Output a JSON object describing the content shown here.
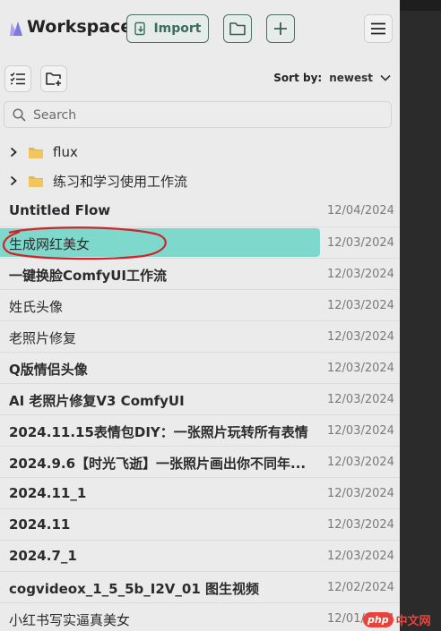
{
  "header": {
    "title": "Workspace",
    "import_label": "Import",
    "icons": {
      "logo": "workspace-logo",
      "import": "import-icon",
      "folder": "folder-icon",
      "add": "plus-icon",
      "menu": "hamburger-icon"
    }
  },
  "toolbar": {
    "sort_label": "Sort by:",
    "sort_value": "newest"
  },
  "search": {
    "placeholder": "Search"
  },
  "folders": [
    {
      "name": "flux"
    },
    {
      "name": "练习和学习使用工作流"
    }
  ],
  "flows": [
    {
      "name": "Untitled Flow",
      "date": "12/04/2024"
    },
    {
      "name": "生成网红美女",
      "date": "12/03/2024",
      "selected": true
    },
    {
      "name": "一键换脸ComfyUI工作流",
      "date": "12/03/2024"
    },
    {
      "name": "姓氏头像",
      "date": "12/03/2024"
    },
    {
      "name": "老照片修复",
      "date": "12/03/2024"
    },
    {
      "name": "Q版情侣头像",
      "date": "12/03/2024"
    },
    {
      "name": "AI 老照片修复V3 ComfyUI",
      "date": "12/03/2024"
    },
    {
      "name": "2024.11.15表情包DIY：一张照片玩转所有表情",
      "date": "12/03/2024"
    },
    {
      "name": "2024.9.6【时光飞逝】一张照片画出你不同年...",
      "date": "12/03/2024"
    },
    {
      "name": "2024.11_1",
      "date": "12/03/2024"
    },
    {
      "name": "2024.11",
      "date": "12/03/2024"
    },
    {
      "name": "2024.7_1",
      "date": "12/03/2024"
    },
    {
      "name": "cogvideox_1_5_5b_I2V_01 图生视频",
      "date": "12/02/2024"
    },
    {
      "name": "小红书写实逼真美女",
      "date": "12/01/2024"
    }
  ],
  "colors": {
    "accent": "#3c6b5f",
    "selected": "#7ed8cb",
    "annotation": "#d2232a"
  },
  "watermark": {
    "badge": "php",
    "text": "中文网"
  }
}
